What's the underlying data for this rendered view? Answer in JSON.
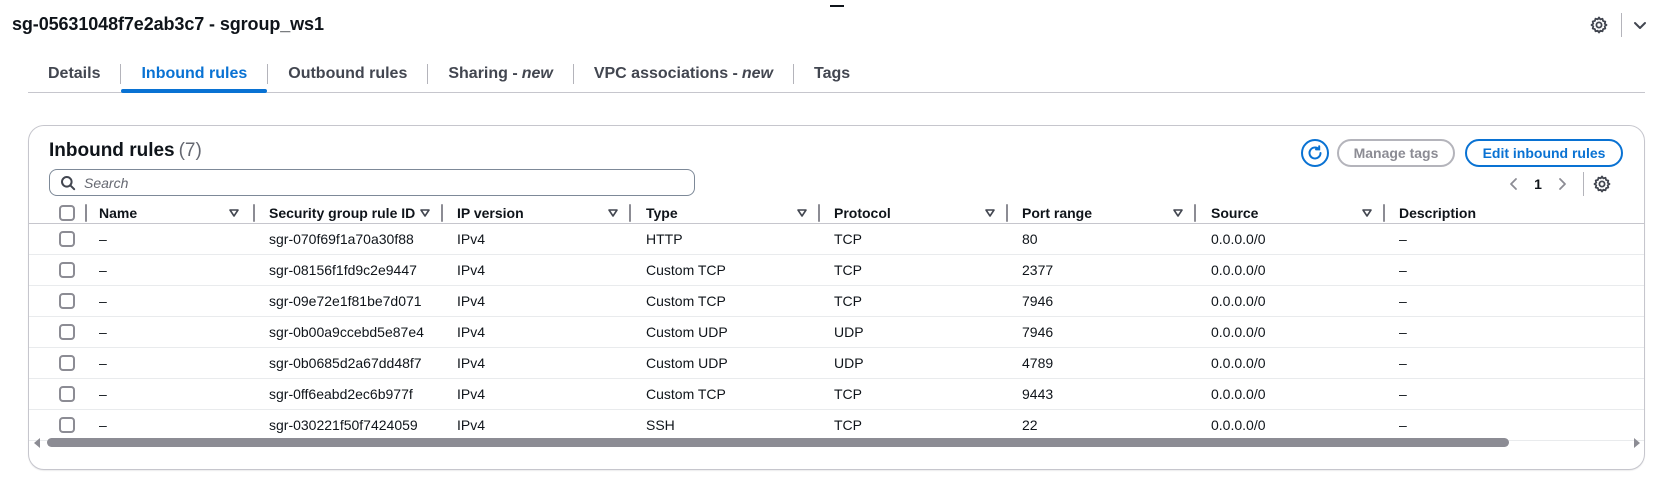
{
  "header": {
    "title": "sg-05631048f7e2ab3c7 - sgroup_ws1"
  },
  "tabs": [
    {
      "label": "Details",
      "suffix": "",
      "active": false
    },
    {
      "label": "Inbound rules",
      "suffix": "",
      "active": true
    },
    {
      "label": "Outbound rules",
      "suffix": "",
      "active": false
    },
    {
      "label": "Sharing - ",
      "suffix": "new",
      "active": false
    },
    {
      "label": "VPC associations - ",
      "suffix": "new",
      "active": false
    },
    {
      "label": "Tags",
      "suffix": "",
      "active": false
    }
  ],
  "panel": {
    "title": "Inbound rules",
    "count": "(7)",
    "manage_tags_label": "Manage tags",
    "edit_label": "Edit inbound rules",
    "search_placeholder": "Search",
    "current_page": "1"
  },
  "table": {
    "columns": [
      "Name",
      "Security group rule ID",
      "IP version",
      "Type",
      "Protocol",
      "Port range",
      "Source",
      "Description"
    ],
    "rows": [
      [
        "–",
        "sgr-070f69f1a70a30f88",
        "IPv4",
        "HTTP",
        "TCP",
        "80",
        "0.0.0.0/0",
        "–"
      ],
      [
        "–",
        "sgr-08156f1fd9c2e9447",
        "IPv4",
        "Custom TCP",
        "TCP",
        "2377",
        "0.0.0.0/0",
        "–"
      ],
      [
        "–",
        "sgr-09e72e1f81be7d071",
        "IPv4",
        "Custom TCP",
        "TCP",
        "7946",
        "0.0.0.0/0",
        "–"
      ],
      [
        "–",
        "sgr-0b00a9ccebd5e87e4",
        "IPv4",
        "Custom UDP",
        "UDP",
        "7946",
        "0.0.0.0/0",
        "–"
      ],
      [
        "–",
        "sgr-0b0685d2a67dd48f7",
        "IPv4",
        "Custom UDP",
        "UDP",
        "4789",
        "0.0.0.0/0",
        "–"
      ],
      [
        "–",
        "sgr-0ff6eabd2ec6b977f",
        "IPv4",
        "Custom TCP",
        "TCP",
        "9443",
        "0.0.0.0/0",
        "–"
      ],
      [
        "–",
        "sgr-030221f50f7424059",
        "IPv4",
        "SSH",
        "TCP",
        "22",
        "0.0.0.0/0",
        "–"
      ]
    ]
  },
  "colors": {
    "accent": "#0972d3",
    "text": "#0f141a",
    "muted": "#656871",
    "border": "#c6c6cd"
  },
  "icons": [
    "settings-icon",
    "chevron-down-icon",
    "refresh-icon",
    "search-icon",
    "chevron-left-icon",
    "chevron-right-icon",
    "sort-caret-icon"
  ]
}
